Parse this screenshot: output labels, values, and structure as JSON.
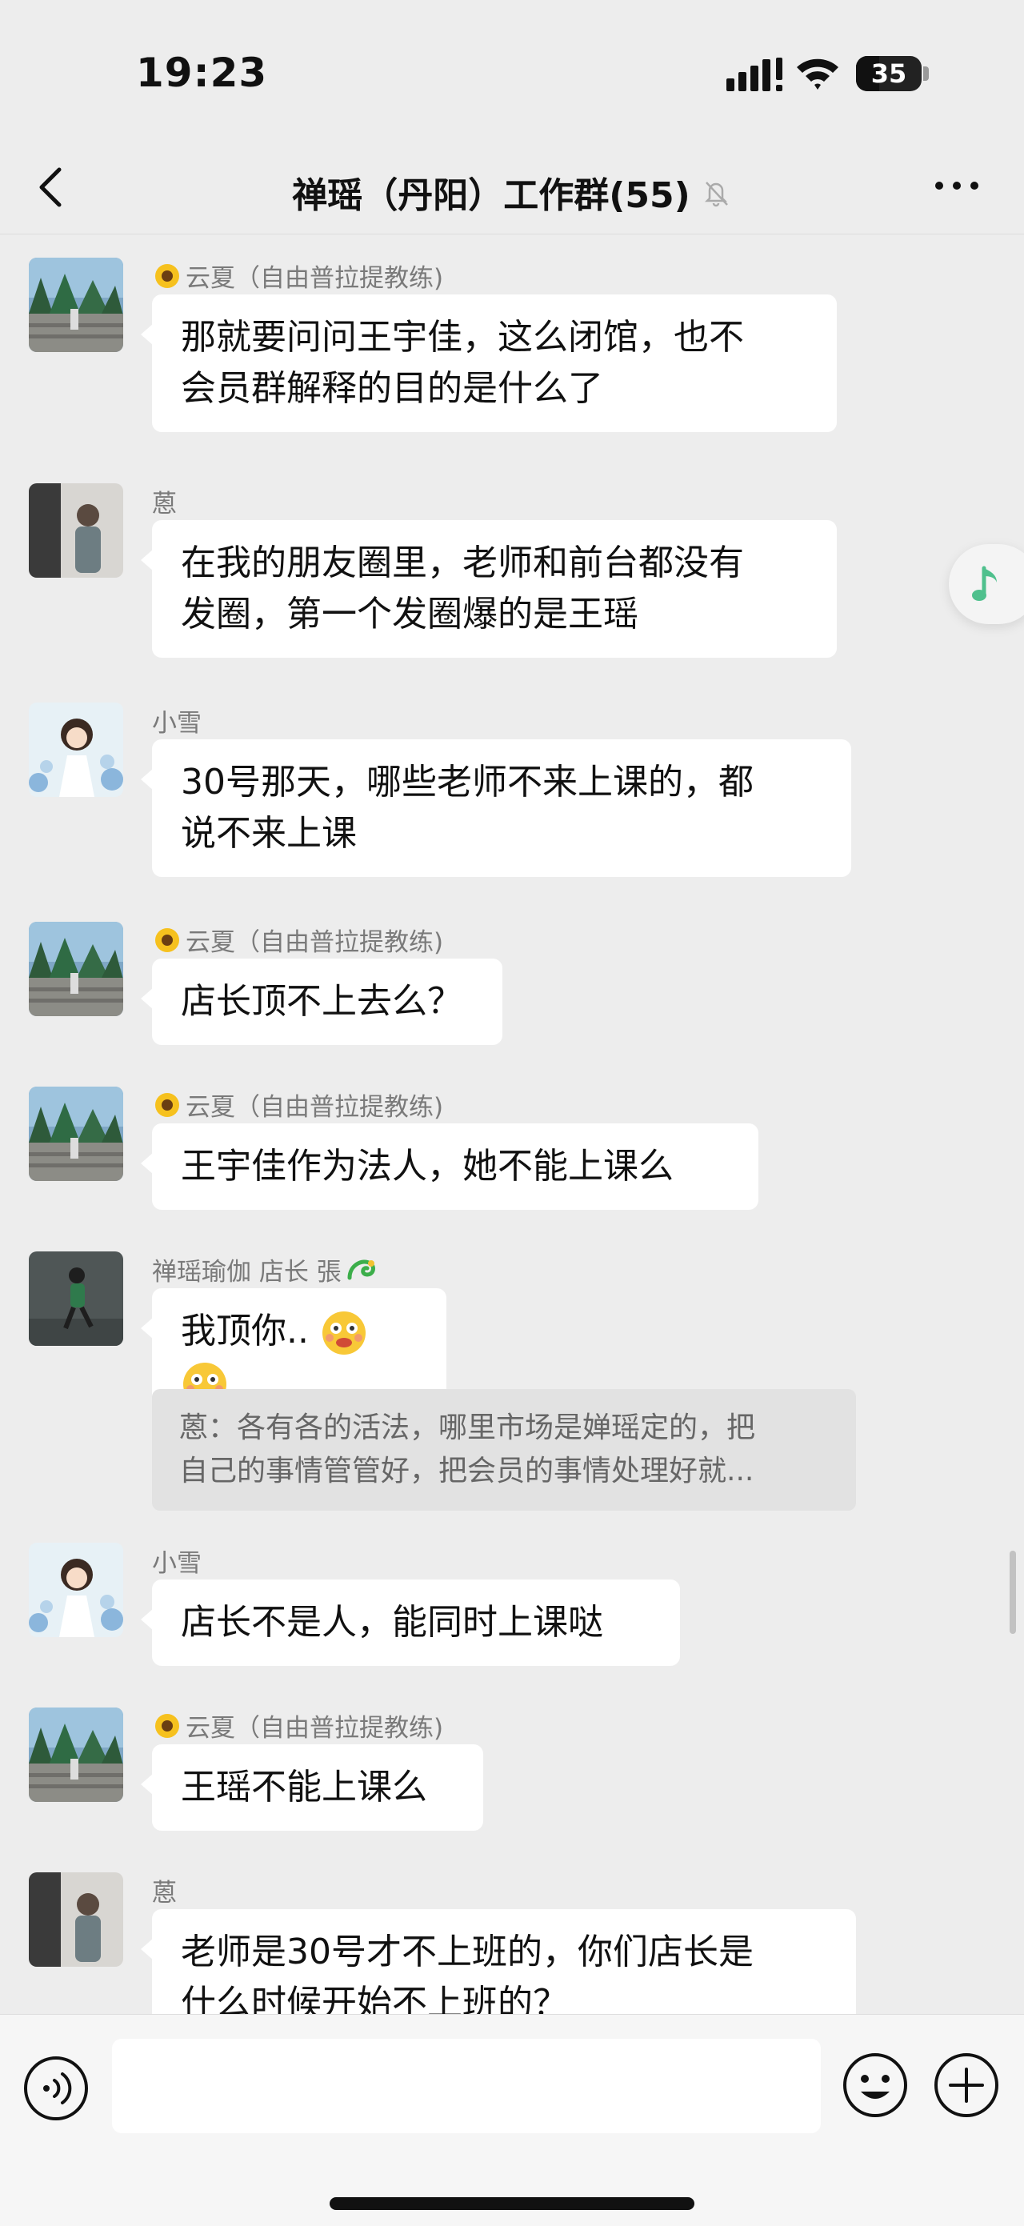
{
  "status_bar": {
    "time": "19:23",
    "battery": "35"
  },
  "header": {
    "title": "禅瑶（丹阳）工作群(55)"
  },
  "messages": [
    {
      "sender": "云夏（自由普拉提教练)",
      "has_flower": true,
      "lines": [
        "那就要问问王宇佳，这么闭馆，也不",
        "会员群解释的目的是什么了"
      ]
    },
    {
      "sender": "蒽",
      "has_flower": false,
      "lines": [
        "在我的朋友圈里，老师和前台都没有",
        "发圈，第一个发圈爆的是王瑶"
      ]
    },
    {
      "sender": "小雪",
      "has_flower": false,
      "lines": [
        "30号那天，哪些老师不来上课的，都",
        "说不来上课"
      ]
    },
    {
      "sender": "云夏（自由普拉提教练)",
      "has_flower": true,
      "lines": [
        "店长顶不上去么？"
      ]
    },
    {
      "sender": "云夏（自由普拉提教练)",
      "has_flower": true,
      "lines": [
        "王宇佳作为法人，她不能上课么"
      ]
    },
    {
      "sender": "禅瑶瑜伽  店长 張",
      "has_flower": false,
      "lines": [
        "我顶你.."
      ],
      "quote": [
        "蒽：各有各的活法，哪里市场是婵瑶定的，把",
        "自己的事情管管好，把会员的事情处理好就..."
      ]
    },
    {
      "sender": "小雪",
      "has_flower": false,
      "lines": [
        "店长不是人，能同时上课哒"
      ]
    },
    {
      "sender": "云夏（自由普拉提教练)",
      "has_flower": true,
      "lines": [
        "王瑶不能上课么"
      ]
    },
    {
      "sender": "蒽",
      "has_flower": false,
      "lines": [
        "老师是30号才不上班的，你们店长是",
        "什么时候开始不上班的？"
      ]
    }
  ]
}
